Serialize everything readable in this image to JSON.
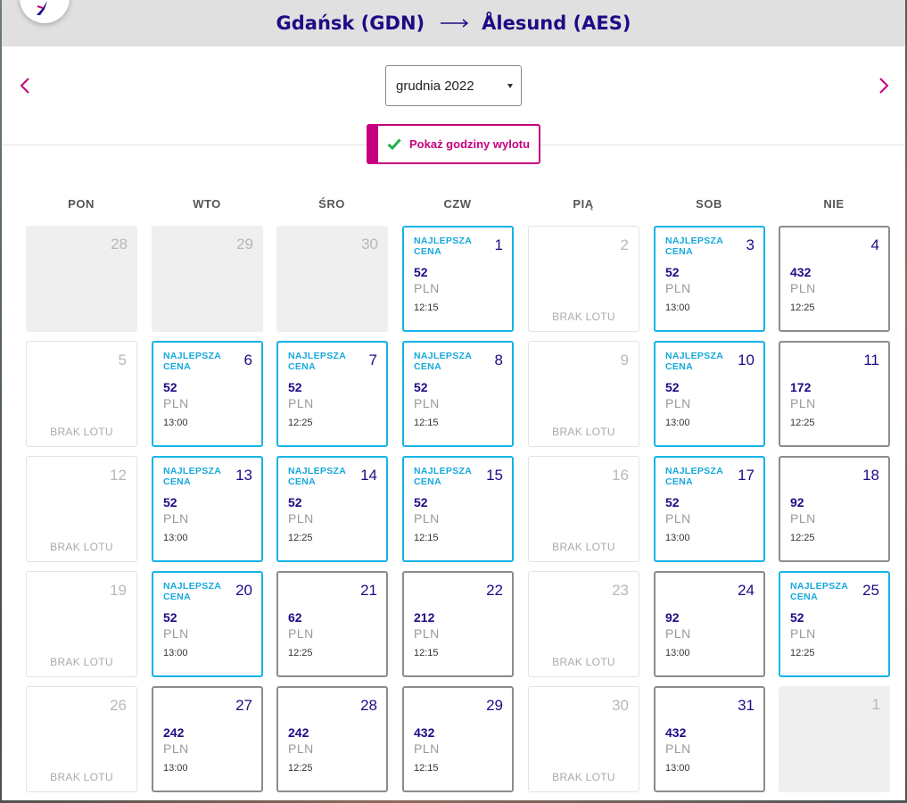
{
  "header": {
    "origin": "Gdańsk (GDN)",
    "destination": "Ålesund (AES)",
    "logo_icon": "plane-icon"
  },
  "month_select": {
    "value": "grudnia 2022"
  },
  "toggle": {
    "label": "Pokaż godziny wylotu"
  },
  "weekdays": [
    "PON",
    "WTO",
    "ŚRO",
    "CZW",
    "PIĄ",
    "SOB",
    "NIE"
  ],
  "labels": {
    "best": "NAJLEPSZA CENA",
    "no_flight": "BRAK LOTU",
    "currency": "PLN"
  },
  "colors": {
    "accent": "#c6007e",
    "navy": "#1f0a86",
    "best": "#16b3e8"
  },
  "weeks": [
    [
      {
        "day": "28",
        "state": "empty"
      },
      {
        "day": "29",
        "state": "empty"
      },
      {
        "day": "30",
        "state": "empty"
      },
      {
        "day": "1",
        "state": "best",
        "price": "52",
        "time": "12:15"
      },
      {
        "day": "2",
        "state": "none"
      },
      {
        "day": "3",
        "state": "best",
        "price": "52",
        "time": "13:00"
      },
      {
        "day": "4",
        "state": "flight",
        "price": "432",
        "time": "12:25"
      }
    ],
    [
      {
        "day": "5",
        "state": "none"
      },
      {
        "day": "6",
        "state": "best",
        "price": "52",
        "time": "13:00"
      },
      {
        "day": "7",
        "state": "best",
        "price": "52",
        "time": "12:25"
      },
      {
        "day": "8",
        "state": "best",
        "price": "52",
        "time": "12:15"
      },
      {
        "day": "9",
        "state": "none"
      },
      {
        "day": "10",
        "state": "best",
        "price": "52",
        "time": "13:00"
      },
      {
        "day": "11",
        "state": "flight",
        "price": "172",
        "time": "12:25"
      }
    ],
    [
      {
        "day": "12",
        "state": "none"
      },
      {
        "day": "13",
        "state": "best",
        "price": "52",
        "time": "13:00"
      },
      {
        "day": "14",
        "state": "best",
        "price": "52",
        "time": "12:25"
      },
      {
        "day": "15",
        "state": "best",
        "price": "52",
        "time": "12:15"
      },
      {
        "day": "16",
        "state": "none"
      },
      {
        "day": "17",
        "state": "best",
        "price": "52",
        "time": "13:00"
      },
      {
        "day": "18",
        "state": "flight",
        "price": "92",
        "time": "12:25"
      }
    ],
    [
      {
        "day": "19",
        "state": "none"
      },
      {
        "day": "20",
        "state": "best",
        "price": "52",
        "time": "13:00"
      },
      {
        "day": "21",
        "state": "flight",
        "price": "62",
        "time": "12:25"
      },
      {
        "day": "22",
        "state": "flight",
        "price": "212",
        "time": "12:15"
      },
      {
        "day": "23",
        "state": "none"
      },
      {
        "day": "24",
        "state": "flight",
        "price": "92",
        "time": "13:00"
      },
      {
        "day": "25",
        "state": "best",
        "price": "52",
        "time": "12:25"
      }
    ],
    [
      {
        "day": "26",
        "state": "none"
      },
      {
        "day": "27",
        "state": "flight",
        "price": "242",
        "time": "13:00"
      },
      {
        "day": "28",
        "state": "flight",
        "price": "242",
        "time": "12:25"
      },
      {
        "day": "29",
        "state": "flight",
        "price": "432",
        "time": "12:15"
      },
      {
        "day": "30",
        "state": "none"
      },
      {
        "day": "31",
        "state": "flight",
        "price": "432",
        "time": "13:00"
      },
      {
        "day": "1",
        "state": "empty"
      }
    ]
  ]
}
